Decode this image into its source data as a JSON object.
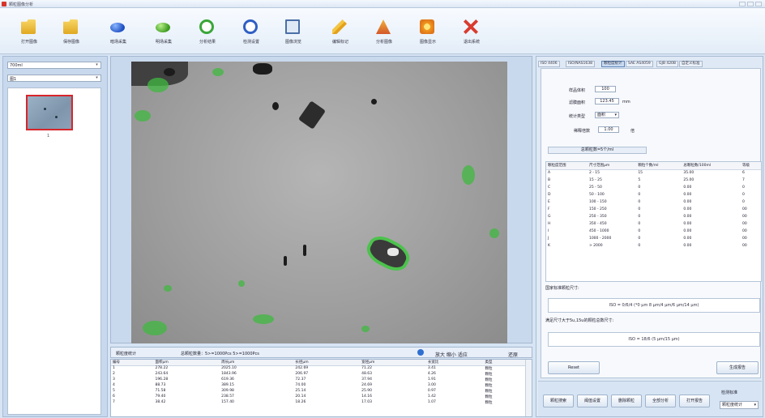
{
  "app": {
    "title": "颗粒图像分析"
  },
  "toolbar": {
    "tools": [
      {
        "label": "打开图像",
        "icon": "folder-open-icon"
      },
      {
        "label": "保存图像",
        "icon": "folder-save-icon"
      },
      {
        "label": "暗场采集",
        "icon": "blue-circle-icon"
      },
      {
        "label": "明场采集",
        "icon": "green-circle-icon"
      },
      {
        "label": "分析结果",
        "icon": "green-ring-icon"
      },
      {
        "label": "检测设置",
        "icon": "blue-ring-icon"
      },
      {
        "label": "图像浏览",
        "icon": "monitor-icon"
      },
      {
        "label": "编辑标记",
        "icon": "pencil-icon"
      },
      {
        "label": "分析图像",
        "icon": "triangle-icon"
      },
      {
        "label": "图像显示",
        "icon": "screen-icon"
      },
      {
        "label": "退出系统",
        "icon": "close-x-icon"
      }
    ]
  },
  "left": {
    "combo1": "700ml",
    "combo2": "图1",
    "thumb_number": "1"
  },
  "stats": {
    "title": "颗粒度统计",
    "summary": "总颗粒数量：5>=1000Pcs  5>=1000Pcs",
    "zoom": "放大 缩小 适应",
    "reset": "还原"
  },
  "results": {
    "headers": [
      "编号",
      "面积μm",
      "周长μm",
      "长径μm",
      "宽径μm",
      "长宽比",
      "类型"
    ],
    "rows": [
      [
        "1",
        "278.22",
        "2025.10",
        "242.69",
        "71.22",
        "3.41",
        "颗粒"
      ],
      [
        "2",
        "243.64",
        "1843.96",
        "206.97",
        "48.63",
        "4.26",
        "颗粒"
      ],
      [
        "3",
        "196.28",
        "619.36",
        "72.37",
        "37.94",
        "1.91",
        "颗粒"
      ],
      [
        "4",
        "88.73",
        "389.15",
        "74.00",
        "24.69",
        "3.00",
        "颗粒"
      ],
      [
        "5",
        "71.58",
        "309.98",
        "25.14",
        "25.90",
        "0.97",
        "颗粒"
      ],
      [
        "6",
        "79.40",
        "238.57",
        "20.14",
        "14.16",
        "1.42",
        "颗粒"
      ],
      [
        "7",
        "38.42",
        "157.40",
        "18.26",
        "17.03",
        "1.07",
        "颗粒"
      ]
    ]
  },
  "right": {
    "tabs": [
      "ISO 4406",
      "ISO/NAS1638",
      "颗粒度统计",
      "SAE AS4059",
      "GJB 420B",
      "自定义标准"
    ],
    "fields": {
      "sample_volume_label": "样品体积",
      "sample_volume": "100",
      "filter_area_label": "滤膜面积",
      "filter_area": "123.45",
      "filter_area_unit": "mm",
      "type_label": "统计类型",
      "type_value": "面积",
      "dilution_label": "稀释倍数",
      "dilution": "1.00",
      "dilution_unit": "倍"
    },
    "pill": "总颗粒数=5个/ml",
    "dist_headers": [
      "颗粒度范围",
      "尺寸范围μm",
      "颗粒个数/ml",
      "总颗粒数/100ml",
      "等级"
    ],
    "dist_rows": [
      [
        "A",
        "2 - 15",
        "15",
        "35.00",
        "6"
      ],
      [
        "B",
        "15 - 25",
        "5",
        "25.00",
        "7"
      ],
      [
        "C",
        "25 - 50",
        "0",
        "0.00",
        "0"
      ],
      [
        "D",
        "50 - 100",
        "0",
        "0.00",
        "0"
      ],
      [
        "E",
        "100 - 150",
        "0",
        "0.00",
        "0"
      ],
      [
        "F",
        "150 - 250",
        "0",
        "0.00",
        "00"
      ],
      [
        "G",
        "250 - 350",
        "0",
        "0.00",
        "00"
      ],
      [
        "H",
        "350 - 450",
        "0",
        "0.00",
        "00"
      ],
      [
        "I",
        "450 - 1000",
        "0",
        "0.00",
        "00"
      ],
      [
        "J",
        "1000 - 2000",
        "0",
        "0.00",
        "00"
      ],
      [
        "K",
        "> 2000",
        "0",
        "0.00",
        "00"
      ]
    ],
    "section1_label": "国家标准颗粒尺寸:",
    "section1_value": "ISO = 0/6/4 (*0 μm 8 μm/4 μm/6 μm/14 μm)",
    "section2_label": "满足尺寸大于5u,15u的颗粒总数尺寸:",
    "section2_value": "ISO = 18/6 (5 μm/15 μm)",
    "reset_button": "Reset",
    "report_button": "生成报告"
  },
  "bottom": {
    "buttons": [
      "颗粒搜索",
      "阈值设置",
      "删除颗粒",
      "全部分析",
      "打开报告"
    ],
    "select_label": "检测标准",
    "select_value": "颗粒度统计"
  }
}
